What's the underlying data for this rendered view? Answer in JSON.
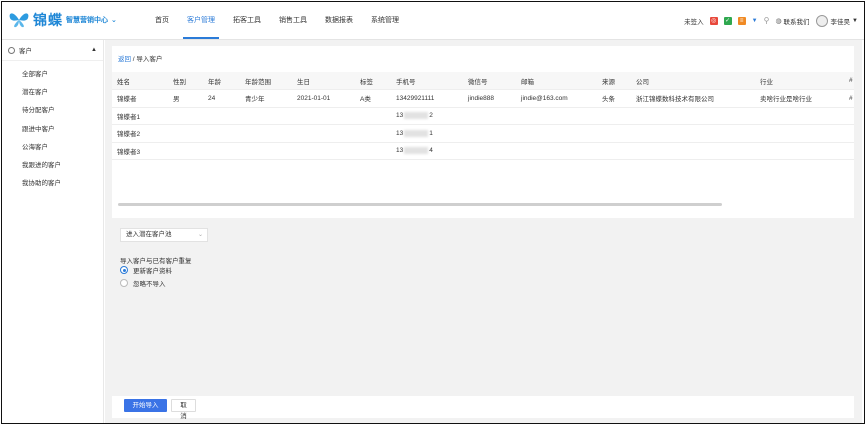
{
  "brand": {
    "logo_text": "锦蝶",
    "subtitle": "智慧营销中心",
    "dropdown": "⌄"
  },
  "nav": [
    {
      "label": "首页"
    },
    {
      "label": "客户管理"
    },
    {
      "label": "拓客工具"
    },
    {
      "label": "销售工具"
    },
    {
      "label": "数据报表"
    },
    {
      "label": "系统管理"
    }
  ],
  "topright": {
    "status": "未签入",
    "contact": "联系我们",
    "user": "李佳昊"
  },
  "sidebar": {
    "header": "客户",
    "items": [
      {
        "label": "全部客户"
      },
      {
        "label": "潜在客户"
      },
      {
        "label": "待分配客户"
      },
      {
        "label": "跟进中客户"
      },
      {
        "label": "公海客户"
      },
      {
        "label": "我跟进的客户"
      },
      {
        "label": "我协助的客户"
      }
    ]
  },
  "breadcrumb": {
    "back": "返回",
    "sep": " / ",
    "current": "导入客户"
  },
  "table": {
    "columns": [
      "姓名",
      "性别",
      "年龄",
      "年龄范围",
      "生日",
      "标签",
      "手机号",
      "微信号",
      "邮箱",
      "来源",
      "公司",
      "行业",
      "#"
    ],
    "rows": [
      {
        "name": "锦蝶者",
        "gender": "男",
        "age": "24",
        "age_range": "青少年",
        "birthday": "2021-01-01",
        "tag": "A类",
        "phone": "13429921111",
        "wechat": "jindie888",
        "email": "jindie@163.com",
        "source": "头条",
        "company": "浙江锦蝶数科技术有限公司",
        "industry": "卖啥行业是啥行业",
        "extra": "#"
      },
      {
        "name": "锦蝶者1",
        "phone_prefix": "13",
        "phone_suffix": "2"
      },
      {
        "name": "锦蝶者2",
        "phone_prefix": "13",
        "phone_suffix": "1"
      },
      {
        "name": "锦蝶者3",
        "phone_prefix": "13",
        "phone_suffix": "4"
      }
    ]
  },
  "import_options": {
    "target_select": "进入潜在客户池",
    "duplicate_label": "导入客户与已有客户重复",
    "radio_update": "更新客户资料",
    "radio_skip": "忽略不导入"
  },
  "footer": {
    "start": "开始导入",
    "cancel": "取消"
  },
  "colors": {
    "accent": "#2b7bd8",
    "primary_button": "#3a73e6"
  }
}
